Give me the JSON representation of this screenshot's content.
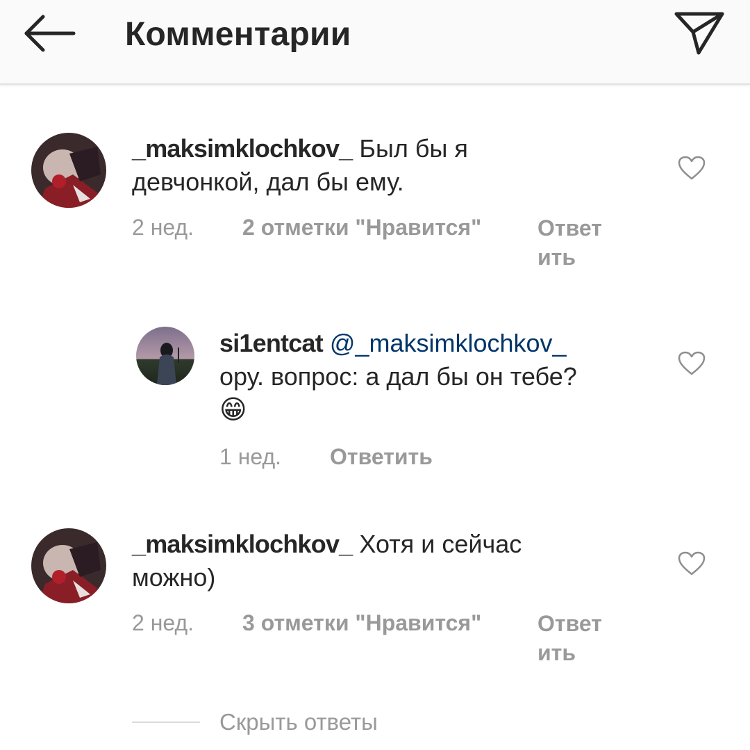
{
  "header": {
    "title": "Комментарии",
    "back_icon": "arrow-left-icon",
    "send_icon": "paper-plane-icon"
  },
  "comments": [
    {
      "username": "_maksimklochkov_",
      "text_line1": "Был бы я",
      "text_line2": "девчонкой, дал бы ему.",
      "time": "2 нед.",
      "likes": "2 отметки \"Нравится\"",
      "reply_line1": "Ответ",
      "reply_line2": "ить"
    },
    {
      "username": "si1entcat",
      "mention": "@_maksimklochkov_",
      "text_line2": "ору. вопрос: а дал бы он тебе?",
      "emoji": "😁",
      "time": "1 нед.",
      "reply": "Ответить"
    },
    {
      "username": "_maksimklochkov_",
      "text_line1": "Хотя и сейчас",
      "text_line2": "можно)",
      "time": "2 нед.",
      "likes": "3 отметки \"Нравится\"",
      "reply_line1": "Ответ",
      "reply_line2": "ить"
    }
  ],
  "hide_replies": "Скрыть ответы",
  "colors": {
    "mention": "#003569",
    "meta": "#999999",
    "text": "#262626",
    "header_bg": "#fafafa"
  }
}
